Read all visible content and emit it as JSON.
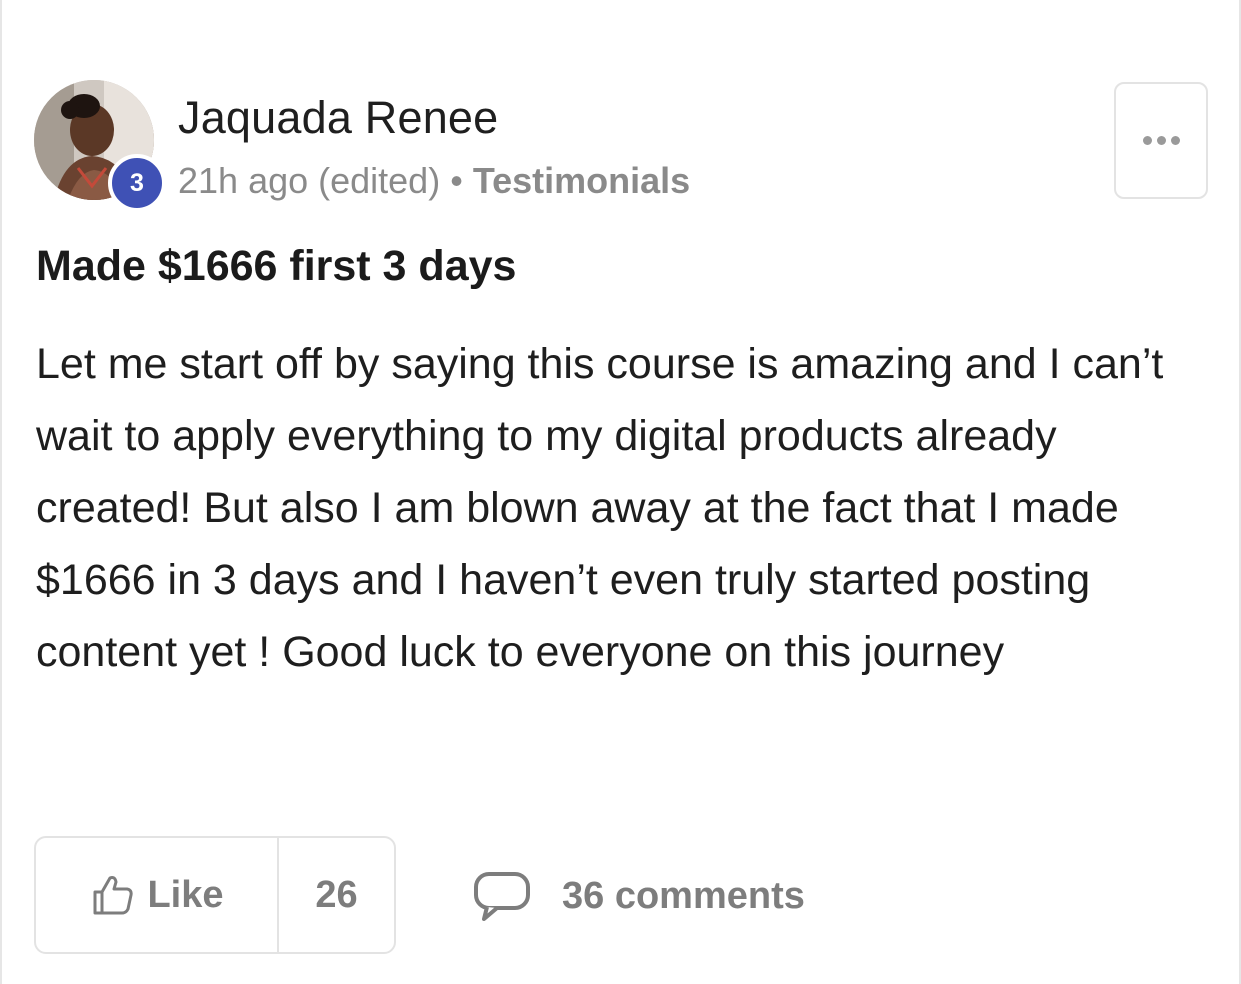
{
  "post": {
    "author": "Jaquada Renee",
    "level": "3",
    "time": "21h ago (edited)",
    "separator": "•",
    "category": "Testimonials",
    "title": "Made $1666 first 3 days",
    "body": "Let me start off by saying this course is amazing and I can’t wait to apply everything to my digital products already created! But also I am blown away at the fact that I made $1666 in 3 days and I haven’t even truly started posting content yet ! Good luck to everyone on this journey"
  },
  "actions": {
    "like_label": "Like",
    "like_count": "26",
    "comments_label": "36 comments"
  },
  "icons": {
    "more": "more-horizontal-icon",
    "like": "thumbs-up-icon",
    "comments": "comment-bubble-icon"
  },
  "colors": {
    "level_badge": "#3f51b5",
    "muted_text": "#7d7d7d",
    "border": "#e3e3e3"
  }
}
